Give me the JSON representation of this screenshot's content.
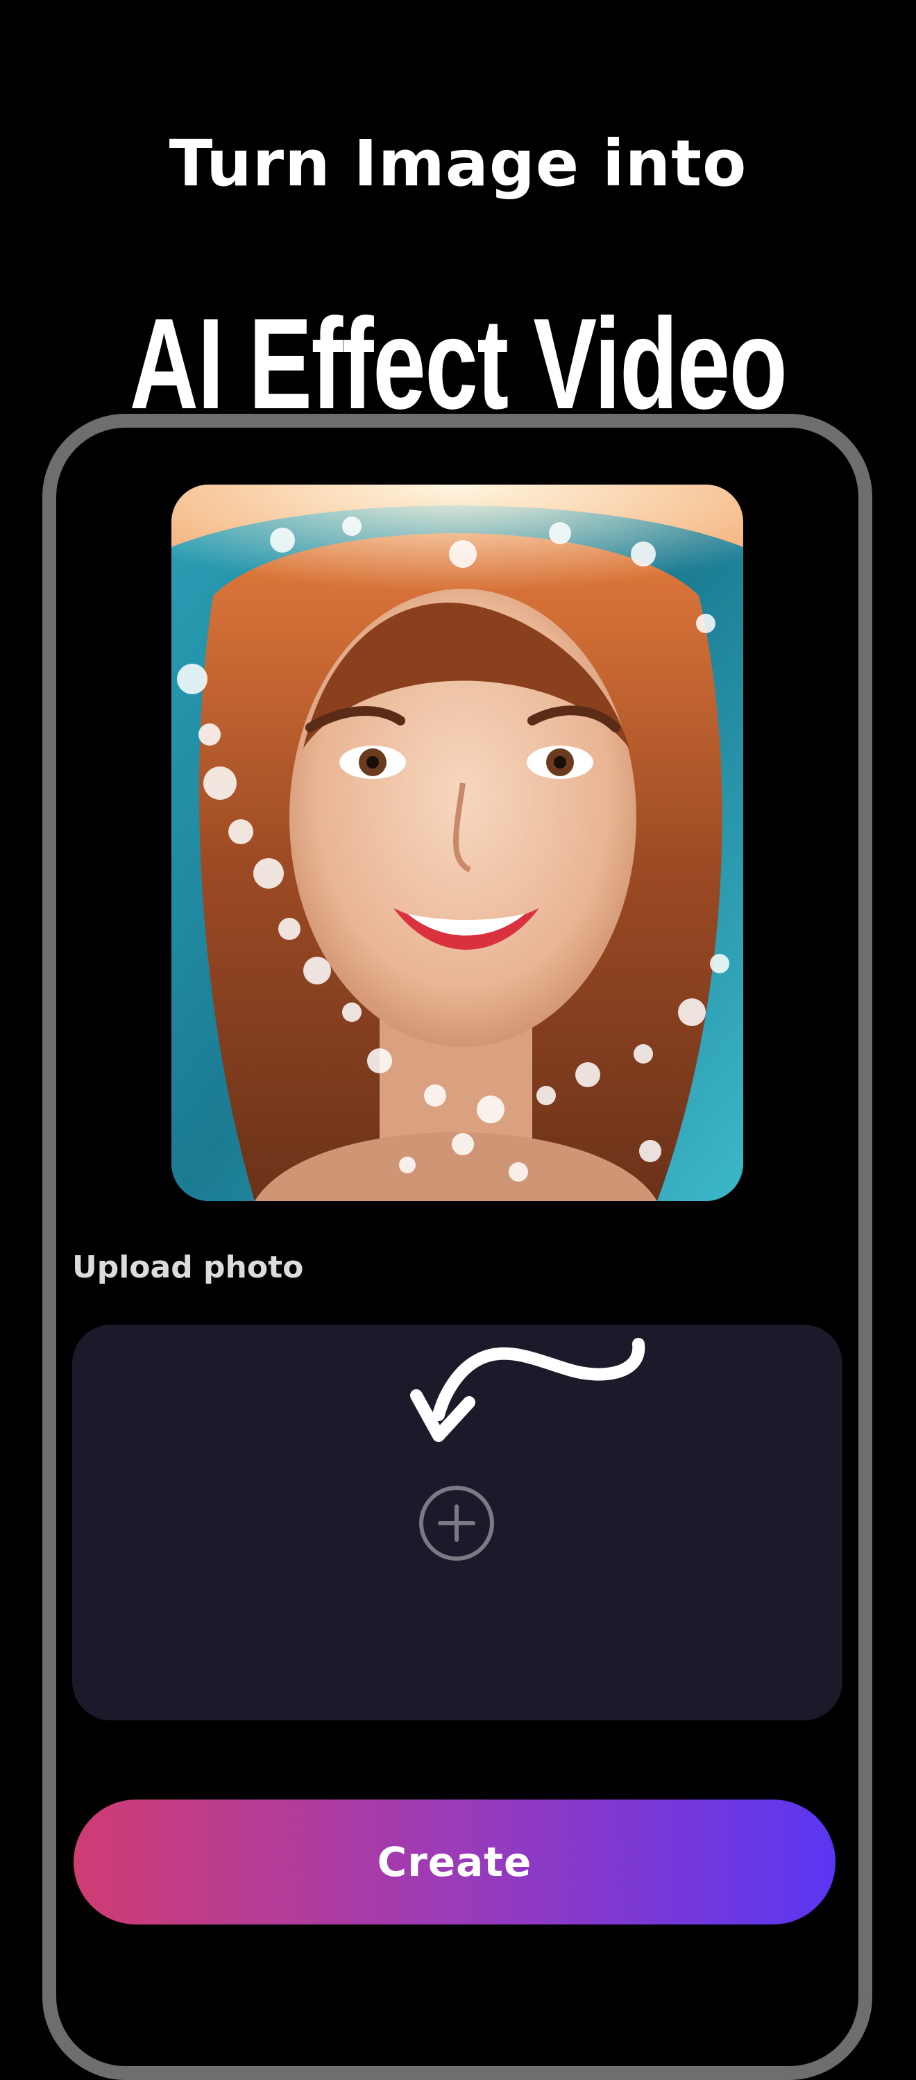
{
  "headline": {
    "line1": "Turn Image into",
    "line2": "AI Effect Video"
  },
  "upload": {
    "section_label": "Upload photo",
    "icon": "plus-circle-icon"
  },
  "actions": {
    "create_label": "Create"
  },
  "colors": {
    "background": "#000000",
    "phone_frame": "#6e6e6e",
    "upload_box": "#1a1a2a",
    "button_gradient_start": "#d03c72",
    "button_gradient_end": "#5a36f2"
  }
}
